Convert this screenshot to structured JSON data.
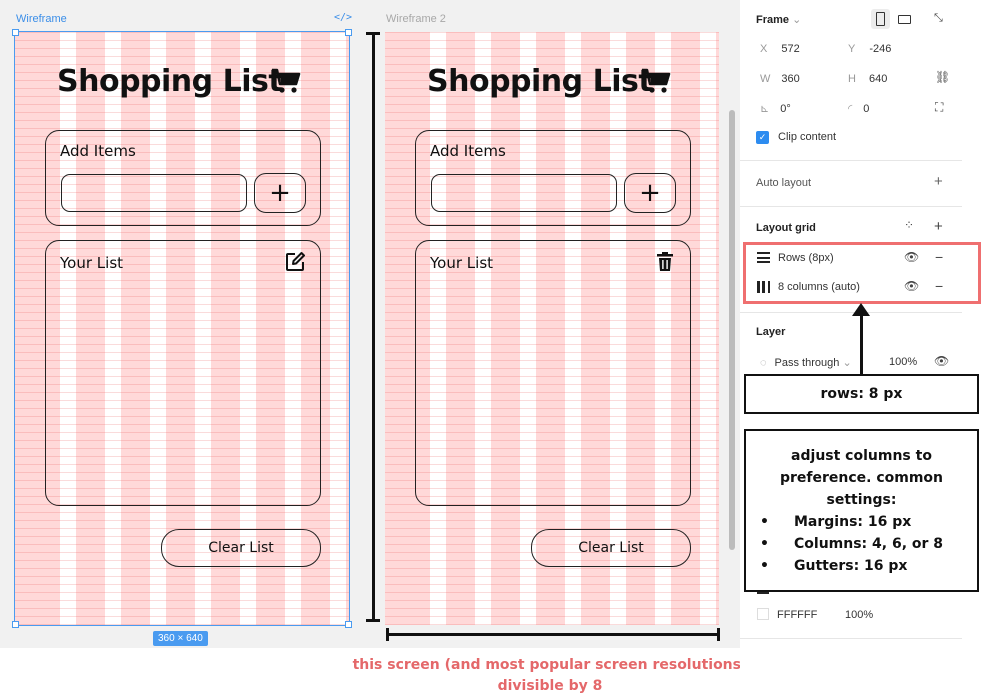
{
  "canvas": {
    "frame1_label": "Wireframe",
    "frame2_label": "Wireframe 2",
    "frame_size_badge": "360 × 640",
    "code_icon_glyph": "</>"
  },
  "app": {
    "title": "Shopping List",
    "add_label": "Add Items",
    "add_input_value": "",
    "plus_glyph": "+",
    "list_label": "Your List",
    "clear_label": "Clear List",
    "frame1_list_icon": "edit-icon",
    "frame2_list_icon": "trash-icon"
  },
  "panel": {
    "frame_title": "Frame",
    "x_key": "X",
    "x_val": "572",
    "y_key": "Y",
    "y_val": "-246",
    "w_key": "W",
    "w_val": "360",
    "h_key": "H",
    "h_val": "640",
    "rotation_val": "0°",
    "radius_val": "0",
    "clip_content": "Clip content",
    "auto_layout": "Auto layout",
    "layout_grid": "Layout grid",
    "grid_rows": "Rows (8px)",
    "grid_cols": "8 columns (auto)",
    "layer": "Layer",
    "blend_mode": "Pass through",
    "opacity": "100%",
    "fill_hex": "FFFFFF",
    "fill_opacity": "100%"
  },
  "notes": {
    "rows": "rows: 8 px",
    "cols_intro": "adjust columns to preference. common settings:",
    "cols_items": [
      "Margins: 16 px",
      "Columns: 4, 6, or 8",
      "Gutters: 16 px"
    ],
    "caption": "this screen (and most popular screen resolutions) divisible by 8"
  },
  "colors": {
    "selection": "#4a9bf0",
    "grid_column": "#ffd9d9",
    "highlight": "#ef6f70",
    "caption": "#e4686a"
  }
}
